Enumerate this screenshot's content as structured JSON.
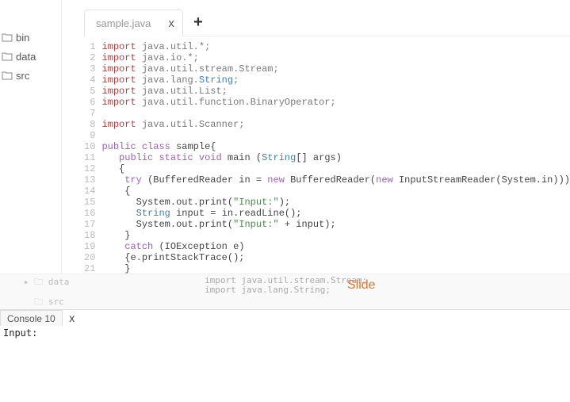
{
  "sidebar": {
    "folders": [
      {
        "label": "bin"
      },
      {
        "label": "data"
      },
      {
        "label": "src"
      }
    ]
  },
  "overlay_sidebar": {
    "item1": "data",
    "item2": "src"
  },
  "editor": {
    "tab_label": "sample.java",
    "tab_close": "x",
    "new_tab": "+",
    "gutter": [
      "1",
      "2",
      "3",
      "4",
      "5",
      "6",
      "7",
      "8",
      "9",
      "10",
      "11",
      "12",
      "13",
      "14",
      "15",
      "16",
      "17",
      "18",
      "19",
      "20",
      "21"
    ],
    "lines": {
      "l1": {
        "a": "import ",
        "b": "java.util.*;"
      },
      "l2": {
        "a": "import ",
        "b": "java.io.*;"
      },
      "l3": {
        "a": "import ",
        "b": "java.util.stream.Stream;"
      },
      "l4": {
        "a": "import ",
        "b": "java.lang.",
        "c": "String",
        "d": ";"
      },
      "l5": {
        "a": "import ",
        "b": "java.util.List;"
      },
      "l6": {
        "a": "import ",
        "b": "java.util.function.BinaryOperator;"
      },
      "l7": "",
      "l8": {
        "a": "import ",
        "b": "java.util.Scanner;"
      },
      "l9": "",
      "l10": {
        "a": "public class ",
        "b": "sample{"
      },
      "l11": {
        "ind": "   ",
        "a": "public static void ",
        "b": "main (",
        "c": "String",
        "d": "[] args)"
      },
      "l12": {
        "ind": "   ",
        "a": "{"
      },
      "l13": {
        "ind": "    ",
        "a": "try ",
        "b": "(BufferedReader in = ",
        "c": "new ",
        "d": "BufferedReader(",
        "e": "new ",
        "f": "InputStreamReader(System.in)))"
      },
      "l14": {
        "ind": "    ",
        "a": "{"
      },
      "l15": {
        "ind": "      ",
        "a": "System.out.print(",
        "b": "\"Input:\"",
        "c": ");"
      },
      "l16": {
        "ind": "      ",
        "a": "String ",
        "b": "input = in.readLine();"
      },
      "l17": {
        "ind": "      ",
        "a": "System.out.print(",
        "b": "\"Input:\" ",
        "c": "+ input);"
      },
      "l18": {
        "ind": "    ",
        "a": "}"
      },
      "l19": {
        "ind": "    ",
        "a": "catch ",
        "b": "(IOException e)"
      },
      "l20": {
        "ind": "    ",
        "a": "{e.printStackTrace();"
      },
      "l21": {
        "ind": "    ",
        "a": "}"
      }
    }
  },
  "overlay": {
    "slide_label": "Slide",
    "faded_lines": {
      "a": "import java.util.stream.Stream;",
      "b": "import java.lang.String;"
    }
  },
  "console": {
    "tab_label": "Console 10",
    "tab_close": "x",
    "output": "Input:"
  }
}
